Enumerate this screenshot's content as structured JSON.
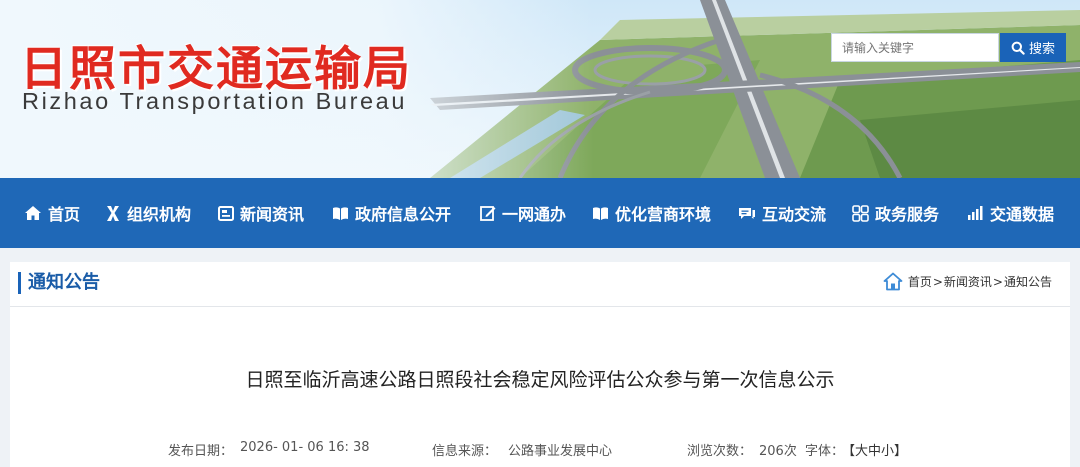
{
  "header": {
    "logo_cn": "日照市交通运输局",
    "logo_en": "Rizhao Transportation Bureau",
    "search_placeholder": "请输入关键字",
    "search_button": "搜索"
  },
  "nav": {
    "items": [
      {
        "label": "首页",
        "icon": "home-icon"
      },
      {
        "label": "组织机构",
        "icon": "org-icon"
      },
      {
        "label": "新闻资讯",
        "icon": "news-icon"
      },
      {
        "label": "政府信息公开",
        "icon": "book-icon"
      },
      {
        "label": "一网通办",
        "icon": "edit-icon"
      },
      {
        "label": "优化营商环境",
        "icon": "book-open-icon"
      },
      {
        "label": "互动交流",
        "icon": "chat-icon"
      },
      {
        "label": "政务服务",
        "icon": "grid-icon"
      },
      {
        "label": "交通数据",
        "icon": "bar-chart-icon"
      }
    ]
  },
  "section": {
    "title": "通知公告",
    "breadcrumb": [
      "首页",
      "新闻资讯",
      "通知公告"
    ]
  },
  "article": {
    "title": "日照至临沂高速公路日照段社会稳定风险评估公众参与第一次信息公示",
    "publish_label": "发布日期：",
    "publish_value": "2026- 01- 06 16: 38",
    "source_label": "信息来源：",
    "source_value": "公路事业发展中心",
    "views_label": "浏览次数：",
    "views_value": "206次",
    "font_label": "字体：",
    "font_options": "【大中小】"
  },
  "colors": {
    "nav_bg": "#1f68b7",
    "logo_red": "#e02a20",
    "accent_blue": "#1a63b8"
  }
}
